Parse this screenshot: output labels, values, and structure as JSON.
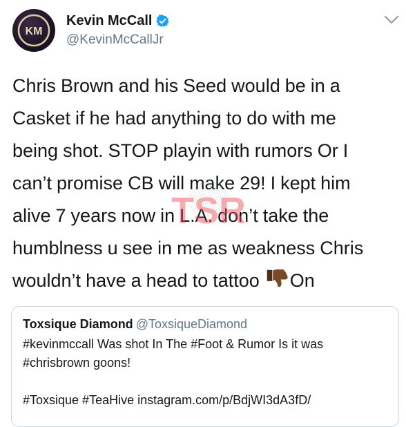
{
  "tweet": {
    "author": {
      "display_name": "Kevin McCall",
      "handle": "@KevinMcCallJr",
      "verified": true,
      "avatar_initials": "KM"
    },
    "text_lines": [
      "Chris Brown and his Seed would be in a",
      "Casket if he had anything to do with me",
      "being shot. STOP playin with rumors Or I",
      "can’t promise CB will make 29! I kept him",
      "alive 7 years now in L.A. don’t take the",
      "humblness u see in me as weakness Chris",
      "wouldn’t have a head to tattoo "
    ],
    "text_end": "On",
    "emoji": "thumbs-down-icon",
    "watermark_text": "TSR",
    "menu_icon": "chevron-down-icon"
  },
  "quoted_tweet": {
    "display_name": "Toxsique Diamond",
    "handle": "@ToxsiqueDiamond",
    "text_lines": [
      "#kevinmccall Was shot In The #Foot & Rumor Is it was",
      "#chrisbrown goons!",
      "",
      "#Toxsique #TeaHive instagram.com/p/BdjWI3dA3fD/"
    ]
  },
  "colors": {
    "text": "#14171a",
    "secondary": "#657786",
    "verified_blue": "#1da1f2",
    "border": "#ccd6dd",
    "watermark_red": "#e8454f"
  }
}
